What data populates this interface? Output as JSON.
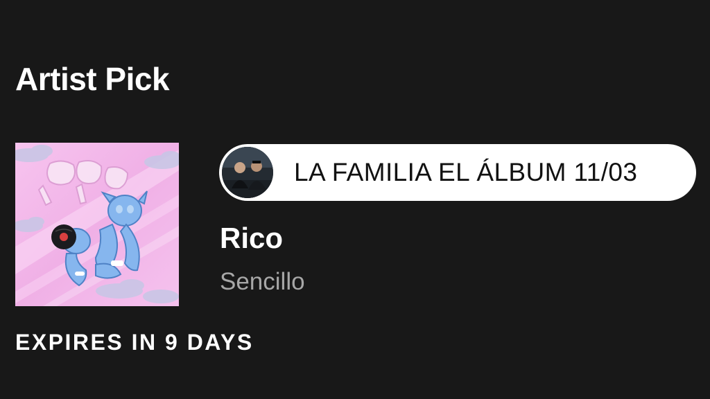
{
  "section": {
    "title": "Artist Pick"
  },
  "pick": {
    "comment": "LA FAMILIA EL ÁLBUM 11/03",
    "release_title": "Rico",
    "release_type": "Sencillo",
    "expires": "EXPIRES IN 9 DAYS"
  },
  "colors": {
    "background": "#181818",
    "cover_pink": "#f2b6e8",
    "character_blue": "#7fb2ea",
    "secondary_text": "#a7a7a7"
  },
  "icons": {
    "cover": "album-cover-art",
    "avatar": "artist-avatar"
  }
}
